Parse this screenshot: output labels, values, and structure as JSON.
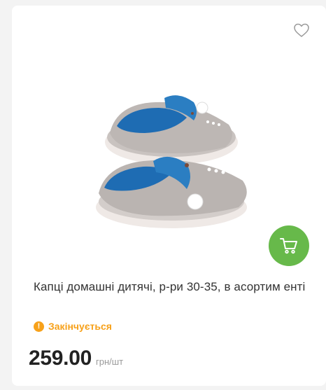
{
  "product": {
    "title": "Капці домашні дитячі, р-ри 30-35, в асортим енті",
    "status": "Закінчується",
    "status_icon": "exclamation-icon",
    "price": "259.00",
    "unit": "грн/шт",
    "favorite_icon": "heart-outline-icon",
    "cart_icon": "cart-icon"
  },
  "colors": {
    "accent_green": "#67b94a",
    "status_orange": "#f7a11a",
    "slipper_gray": "#b9b4b2",
    "slipper_blue": "#1f6fb5"
  }
}
